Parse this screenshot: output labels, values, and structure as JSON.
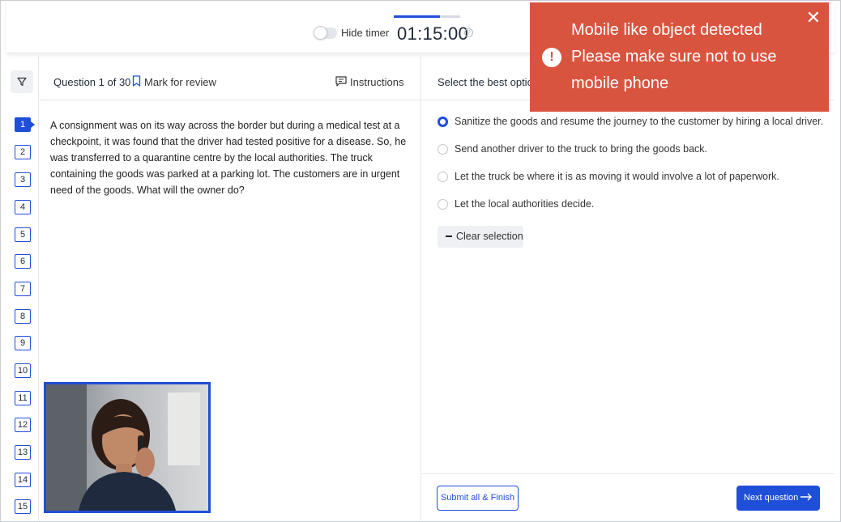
{
  "timer": {
    "hide_label": "Hide timer",
    "value": "01:15:00",
    "help_icon": "help-circle-icon",
    "progress_fraction": 0.7
  },
  "question_header": {
    "count": "Question 1 of 30",
    "mark_for_review": "Mark for review",
    "instructions": "Instructions"
  },
  "nav": {
    "filter_icon": "filter-icon",
    "questions": [
      "1",
      "2",
      "3",
      "4",
      "5",
      "6",
      "7",
      "8",
      "9",
      "10",
      "11",
      "12",
      "13",
      "14",
      "15"
    ],
    "active": "1"
  },
  "question": {
    "text": "A consignment was on its way across the border but during a medical test at a checkpoint, it was found that the driver had tested positive for a disease. So, he was transferred to a quarantine centre by the local authorities. The truck containing the goods was parked at a parking lot. The customers are in urgent need of the goods. What will the owner do?"
  },
  "options": {
    "prompt": "Select the best option",
    "items": [
      {
        "label": "Sanitize the goods and resume the journey to the customer by hiring a local driver.",
        "selected": true
      },
      {
        "label": "Send another driver to the truck to bring the goods back.",
        "selected": false
      },
      {
        "label": "Let the truck be where it is as moving it would involve a lot of paperwork.",
        "selected": false
      },
      {
        "label": "Let the local authorities decide.",
        "selected": false
      }
    ],
    "clear_selection": "Clear selection"
  },
  "footer": {
    "submit": "Submit all & Finish",
    "next": "Next question"
  },
  "alert": {
    "line1": "Mobile like object detected",
    "line2": "Please make sure not to use",
    "line3": "mobile phone",
    "color": "#d9543f"
  },
  "colors": {
    "accent": "#1f4ed8"
  }
}
